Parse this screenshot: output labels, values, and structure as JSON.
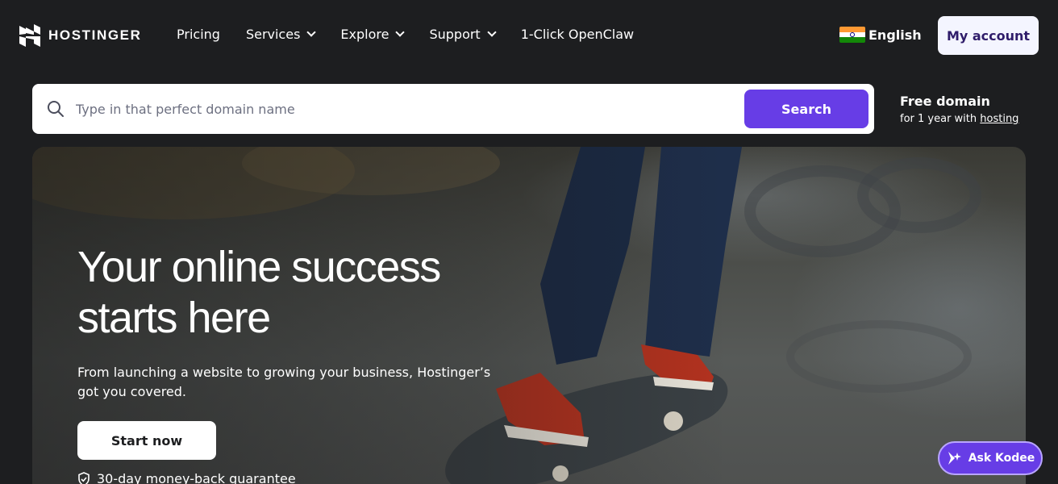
{
  "header": {
    "logo_text": "HOSTINGER",
    "nav": [
      {
        "label": "Pricing",
        "dropdown": false
      },
      {
        "label": "Services",
        "dropdown": true
      },
      {
        "label": "Explore",
        "dropdown": true
      },
      {
        "label": "Support",
        "dropdown": true
      },
      {
        "label": "1-Click OpenClaw",
        "dropdown": false
      }
    ],
    "language": "English",
    "account_label": "My account"
  },
  "search": {
    "placeholder": "Type in that perfect domain name",
    "button_label": "Search",
    "promo_title": "Free domain",
    "promo_prefix": "for 1 year with ",
    "promo_link": "hosting"
  },
  "hero": {
    "title": "Your online success starts here",
    "subtitle": "From launching a website to growing your business, Hostinger’s got you covered.",
    "cta_label": "Start now",
    "guarantee": "30-day money-back guarantee"
  },
  "assistant": {
    "label": "Ask Kodee"
  },
  "colors": {
    "background": "#1d1e20",
    "accent": "#673de6",
    "account_bg": "#f4f5ff"
  }
}
